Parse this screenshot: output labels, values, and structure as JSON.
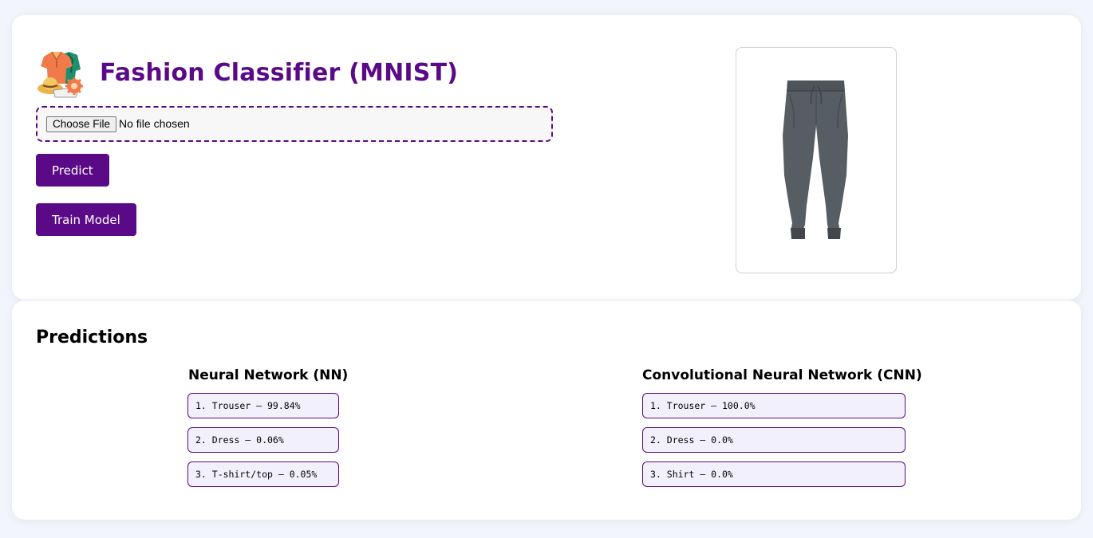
{
  "header": {
    "title": "Fashion Classifier (MNIST)"
  },
  "upload": {
    "choose_file_label": "Choose File",
    "no_file_text": "No file chosen"
  },
  "actions": {
    "predict_label": "Predict",
    "train_label": "Train Model"
  },
  "colors": {
    "accent": "#5a0a86",
    "prediction_bg": "#f2f0fd",
    "page_bg": "#f3f5fc"
  },
  "icons": {
    "logo": "clothing-icon",
    "preview": "trouser-image"
  },
  "predictions": {
    "title": "Predictions",
    "nn": {
      "title": "Neural Network (NN)",
      "items": [
        "1. Trouser — 99.84%",
        "2. Dress — 0.06%",
        "3. T-shirt/top — 0.05%"
      ]
    },
    "cnn": {
      "title": "Convolutional Neural Network (CNN)",
      "items": [
        "1. Trouser — 100.0%",
        "2. Dress — 0.0%",
        "3. Shirt — 0.0%"
      ]
    }
  }
}
